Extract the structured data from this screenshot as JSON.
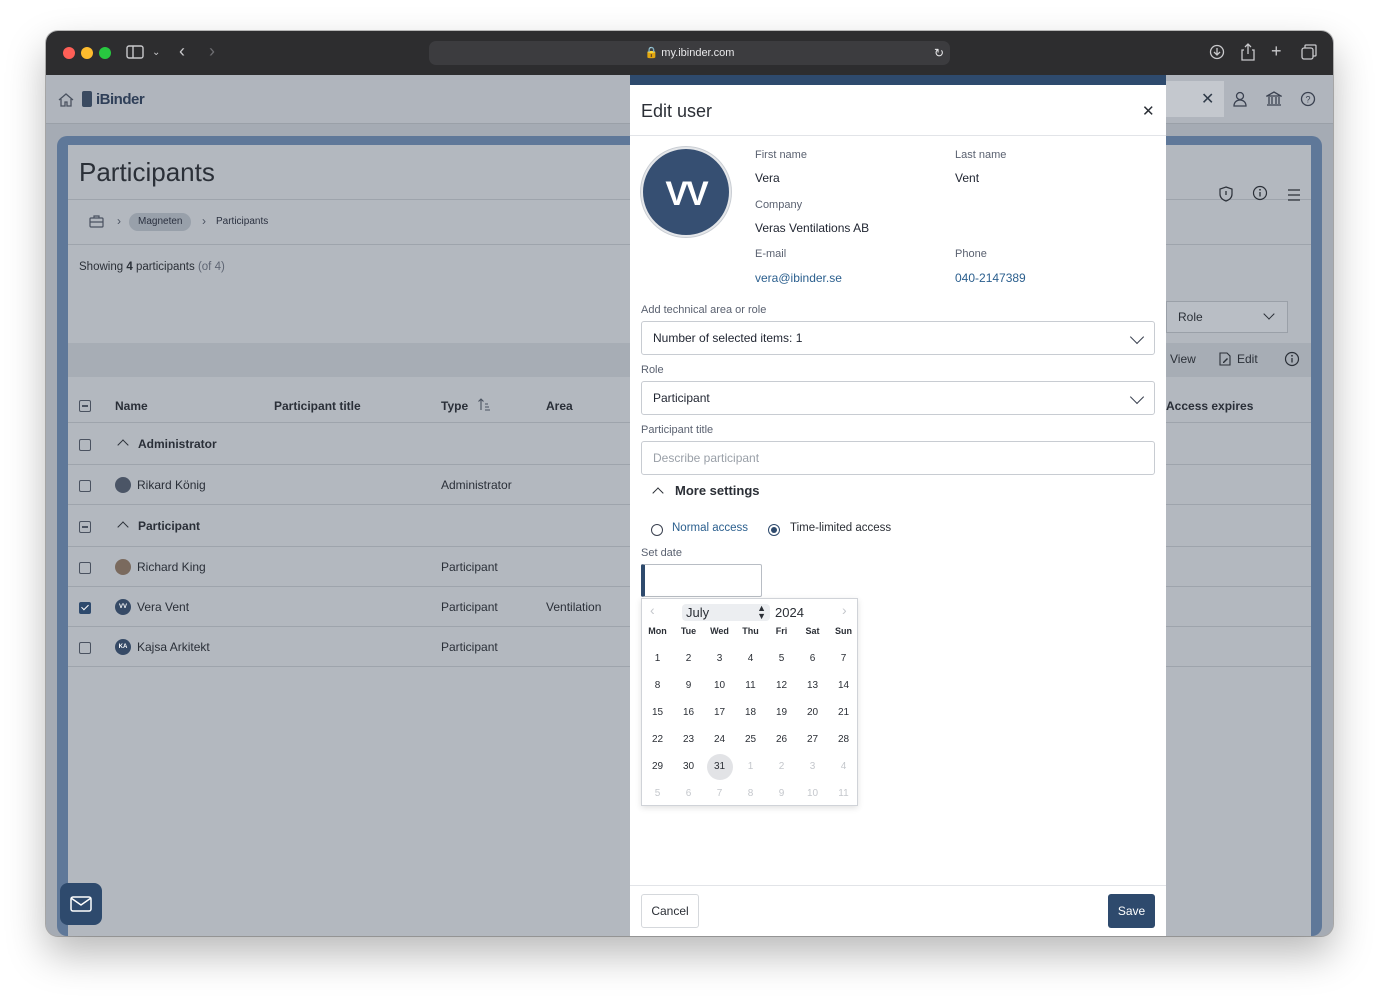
{
  "browser": {
    "url": "my.ibinder.com"
  },
  "app": {
    "logo": "iBinder",
    "header_icons": [
      "home-icon",
      "user-icon",
      "bank-icon",
      "help-icon"
    ]
  },
  "page": {
    "title": "Participants",
    "breadcrumb": [
      "Magneten",
      "Participants"
    ],
    "showing_prefix": "Showing",
    "showing_count": "4",
    "showing_suffix": "participants",
    "showing_total": "(of 4)",
    "role_filter": "Role",
    "actions": {
      "view": "View",
      "edit": "Edit"
    }
  },
  "table": {
    "columns": [
      "Name",
      "Participant title",
      "Type",
      "Area",
      "Access expires"
    ],
    "groups": [
      {
        "name": "Administrator",
        "rows": [
          {
            "name": "Rikard König",
            "type": "Administrator",
            "area": "",
            "initials": "",
            "checked": false
          }
        ]
      },
      {
        "name": "Participant",
        "rows": [
          {
            "name": "Richard King",
            "type": "Participant",
            "area": "",
            "initials": "",
            "checked": false
          },
          {
            "name": "Vera Vent",
            "type": "Participant",
            "area": "Ventilation",
            "initials": "VV",
            "checked": true
          },
          {
            "name": "Kajsa Arkitekt",
            "type": "Participant",
            "area": "",
            "initials": "KA",
            "checked": false
          }
        ]
      }
    ]
  },
  "modal": {
    "title": "Edit user",
    "avatar_initials": "VV",
    "first_name_label": "First name",
    "first_name": "Vera",
    "last_name_label": "Last name",
    "last_name": "Vent",
    "company_label": "Company",
    "company": "Veras Ventilations AB",
    "email_label": "E-mail",
    "email": "vera@ibinder.se",
    "phone_label": "Phone",
    "phone": "040-2147389",
    "tech_area_label": "Add technical area or role",
    "tech_area_value": "Number of selected items: 1",
    "role_label": "Role",
    "role_value": "Participant",
    "participant_title_label": "Participant title",
    "participant_title_placeholder": "Describe participant",
    "more_settings": "More settings",
    "access_normal": "Normal access",
    "access_limited": "Time-limited access",
    "access_selected": "Time-limited access",
    "set_date_label": "Set date",
    "cancel": "Cancel",
    "save": "Save"
  },
  "calendar": {
    "month": "July",
    "year": "2024",
    "weekdays": [
      "Mon",
      "Tue",
      "Wed",
      "Thu",
      "Fri",
      "Sat",
      "Sun"
    ],
    "weeks": [
      [
        "1",
        "2",
        "3",
        "4",
        "5",
        "6",
        "7"
      ],
      [
        "8",
        "9",
        "10",
        "11",
        "12",
        "13",
        "14"
      ],
      [
        "15",
        "16",
        "17",
        "18",
        "19",
        "20",
        "21"
      ],
      [
        "22",
        "23",
        "24",
        "25",
        "26",
        "27",
        "28"
      ],
      [
        "29",
        "30",
        "31",
        "1",
        "2",
        "3",
        "4"
      ],
      [
        "5",
        "6",
        "7",
        "8",
        "9",
        "10",
        "11"
      ]
    ],
    "selected_day": "31"
  },
  "colors": {
    "primary": "#2e4a6d",
    "link": "#2b5f8e",
    "overlay_bg": "#b3b8bf"
  }
}
